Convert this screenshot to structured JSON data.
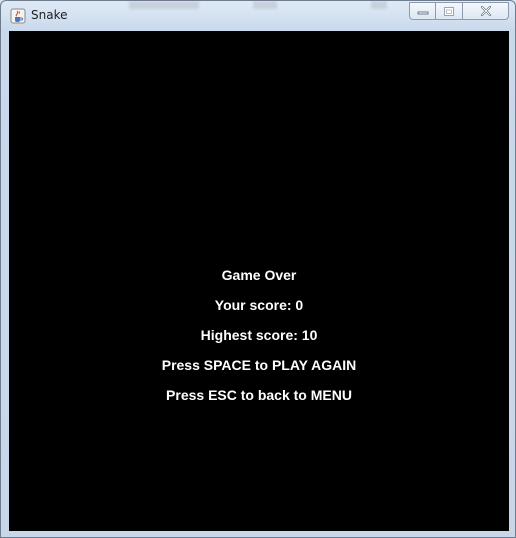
{
  "window": {
    "title": "Snake",
    "app_icon": "java-cup-icon",
    "controls": {
      "minimize_icon": "minimize-icon",
      "maximize_icon": "maximize-icon",
      "close_icon": "close-icon"
    }
  },
  "game": {
    "background_color": "#000000",
    "text_color": "#ffffff",
    "game_over": "Game Over",
    "your_score": "Your score: 0",
    "highest_score": "Highest score: 10",
    "play_again_hint": "Press SPACE to PLAY AGAIN",
    "menu_hint": "Press ESC to back to MENU"
  }
}
